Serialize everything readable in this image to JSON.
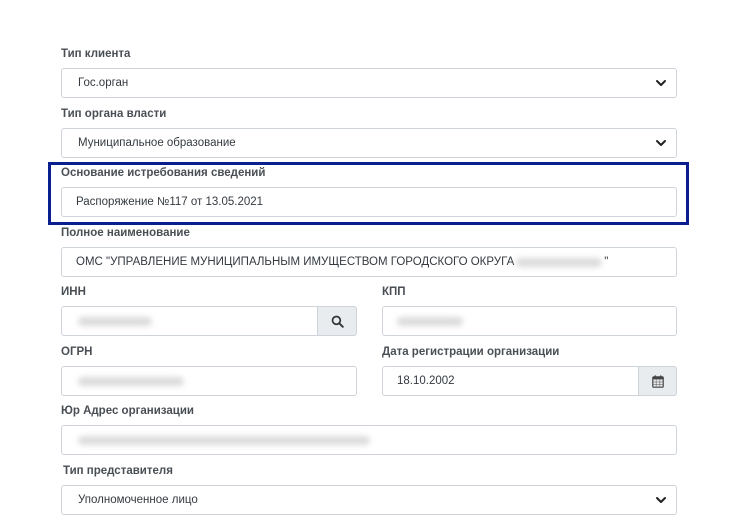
{
  "form": {
    "client_type": {
      "label": "Тип клиента",
      "value": "Гос.орган"
    },
    "authority_type": {
      "label": "Тип органа власти",
      "value": "Муниципальное образование"
    },
    "request_basis": {
      "label": "Основание истребования сведений",
      "value": "Распоряжение №117 от 13.05.2021"
    },
    "full_name": {
      "label": "Полное наименование",
      "value_prefix": "ОМС \"УПРАВЛЕНИЕ МУНИЦИПАЛЬНЫМ ИМУЩЕСТВОМ ГОРОДСКОГО ОКРУГА ",
      "value_suffix": "\""
    },
    "inn": {
      "label": "ИНН"
    },
    "kpp": {
      "label": "КПП"
    },
    "ogrn": {
      "label": "ОГРН"
    },
    "registration_date": {
      "label": "Дата регистрации организации",
      "value": "18.10.2002"
    },
    "legal_address": {
      "label": "Юр Адрес организации"
    },
    "representative_type": {
      "label": "Тип представителя",
      "value": "Уполномоченное лицо"
    }
  },
  "icons": {
    "select_chevron": "chevron-down-icon",
    "search": "search-icon",
    "calendar": "calendar-icon"
  },
  "colors": {
    "highlight_border": "#0a1f8f",
    "addon_background": "#e9ecef",
    "input_border": "#ced4da"
  }
}
